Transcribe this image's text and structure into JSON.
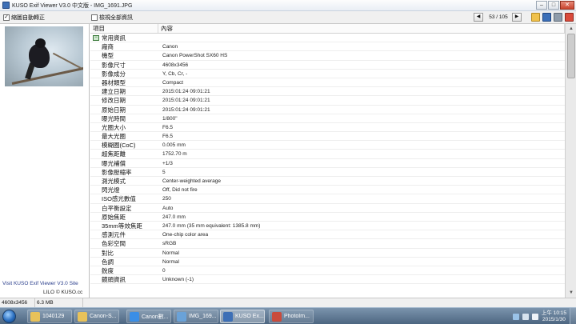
{
  "window": {
    "title": "KUSO Exif Viewer V3.0 中文版 - IMG_1691.JPG"
  },
  "toolbar": {
    "auto_rotate_label": "縮圖自動轉正",
    "auto_rotate_checked": true,
    "show_all_label": "檢視全部資訊",
    "show_all_checked": false,
    "counter": "53 / 105"
  },
  "left_pane": {
    "site_link": "Visit KUSO Exif Viewer V3.0 Site",
    "credit": "LILO © KUSO.cc"
  },
  "table": {
    "headers": [
      "項目",
      "內容"
    ],
    "group_label": "常用資訊",
    "rows": [
      {
        "key": "廠商",
        "value": "Canon"
      },
      {
        "key": "機型",
        "value": "Canon PowerShot SX60 HS"
      },
      {
        "key": "影像尺寸",
        "value": "4608x3456"
      },
      {
        "key": "影像成分",
        "value": "Y, Cb, Cr, -"
      },
      {
        "key": "器材類型",
        "value": "Compact"
      },
      {
        "key": "建立日期",
        "value": "2015:01:24 09:01:21"
      },
      {
        "key": "修改日期",
        "value": "2015:01:24 09:01:21"
      },
      {
        "key": "原始日期",
        "value": "2015:01:24 09:01:21"
      },
      {
        "key": "曝光時間",
        "value": "1/800\""
      },
      {
        "key": "光圈大小",
        "value": "F6.5"
      },
      {
        "key": "最大光圈",
        "value": "F6.5"
      },
      {
        "key": "模糊圈(CoC)",
        "value": "0.005 mm"
      },
      {
        "key": "超焦距離",
        "value": "1752.70 m"
      },
      {
        "key": "曝光補償",
        "value": "+1/3"
      },
      {
        "key": "影像壓縮率",
        "value": "5"
      },
      {
        "key": "測光模式",
        "value": "Center-weighted average"
      },
      {
        "key": "閃光燈",
        "value": "Off, Did not fire"
      },
      {
        "key": "ISO感光數值",
        "value": "250"
      },
      {
        "key": "白平衡設定",
        "value": "Auto"
      },
      {
        "key": "原始焦距",
        "value": "247.0 mm"
      },
      {
        "key": "35mm等效焦距",
        "value": "247.0 mm (35 mm equivalent: 1385.8 mm)"
      },
      {
        "key": "感測元件",
        "value": "One-chip color area"
      },
      {
        "key": "色彩空間",
        "value": "sRGB"
      },
      {
        "key": "對比",
        "value": "Normal"
      },
      {
        "key": "色調",
        "value": "Normal"
      },
      {
        "key": "銳度",
        "value": "0"
      },
      {
        "key": "鏡頭資訊",
        "value": "Unknown (-1)"
      }
    ]
  },
  "status": {
    "dimensions": "4608x3456",
    "filesize": "6.3 MB"
  },
  "taskbar": {
    "items": [
      {
        "label": "1040129",
        "icon": "folder-icon",
        "color": "#e8c25a"
      },
      {
        "label": "Canon-S...",
        "icon": "folder-icon",
        "color": "#e8c25a"
      },
      {
        "label": "Canon數...",
        "icon": "ie-icon",
        "color": "#3a8ee6"
      },
      {
        "label": "IMG_169...",
        "icon": "image-viewer-icon",
        "color": "#6aa2d8"
      },
      {
        "label": "KUSO Ex...",
        "icon": "kuso-exif-icon",
        "color": "#3d6fb6"
      },
      {
        "label": "PhotoIm...",
        "icon": "photoimpact-icon",
        "color": "#c94b3c"
      }
    ],
    "clock_time": "上午 10:15",
    "clock_date": "2015/1/30"
  }
}
